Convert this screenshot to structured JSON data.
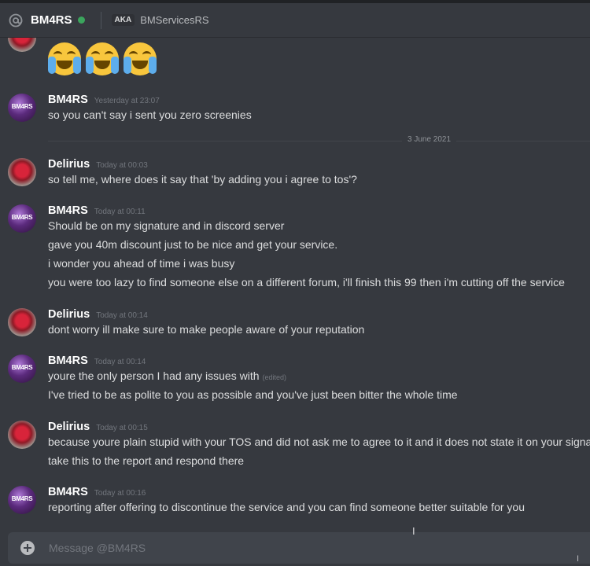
{
  "header": {
    "name": "BM4RS",
    "status_color": "#3ba55d",
    "aka_tag": "AKA",
    "alias": "BMServicesRS",
    "icon": "at-icon"
  },
  "divider": {
    "date": "3 June 2021"
  },
  "messages": [
    {
      "author": "BM4RS",
      "timestamp": "Yesterday at 23:07",
      "lines": [
        "so you can't say i sent you zero screenies"
      ]
    },
    {
      "author": "Delirius",
      "timestamp": "Today at 00:03",
      "lines": [
        "so tell me, where does it say that 'by adding you i agree to tos'?"
      ]
    },
    {
      "author": "BM4RS",
      "timestamp": "Today at 00:11",
      "lines": [
        "Should be on my signature and in discord server",
        "gave you 40m discount just to be nice and get your service.",
        "i wonder you ahead of time i was busy",
        "you were too lazy to find someone else on a different forum, i'll finish this 99 then i'm cutting off the service"
      ]
    },
    {
      "author": "Delirius",
      "timestamp": "Today at 00:14",
      "lines": [
        "dont worry ill make sure to make people aware of your reputation"
      ]
    },
    {
      "author": "BM4RS",
      "timestamp": "Today at 00:14",
      "lines": [
        "youre the only person I had any issues with",
        "I've tried to be as polite to you as possible and you've just been bitter the whole time"
      ],
      "edited": "(edited)"
    },
    {
      "author": "Delirius",
      "timestamp": "Today at 00:15",
      "lines": [
        "because youre plain stupid with your TOS and did not ask me to agree to it and it does not state it on your signatu",
        "take this to the report and respond there"
      ]
    },
    {
      "author": "BM4RS",
      "timestamp": "Today at 00:16",
      "lines": [
        "reporting after offering to discontinue the service and you can find someone better suitable for you"
      ]
    }
  ],
  "avatar_text": "BM4RS",
  "emoji": {
    "name": "joy-emoji",
    "count": 3
  },
  "composer": {
    "placeholder": "Message @BM4RS",
    "value": "",
    "icon": "plus-circle-icon"
  },
  "text_cursor": "I"
}
